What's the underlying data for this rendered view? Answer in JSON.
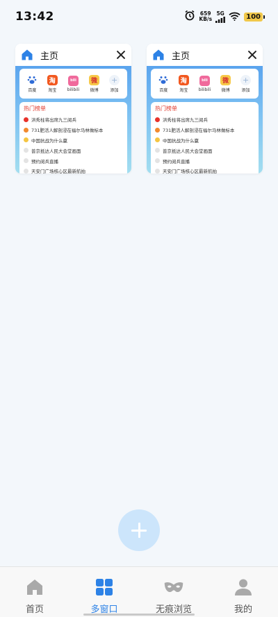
{
  "status_bar": {
    "time": "13:42",
    "speed_value": "659",
    "speed_unit": "KB/s",
    "network": "5G",
    "battery": "100"
  },
  "tabs": [
    {
      "title": "主页",
      "quick_links": [
        "百度",
        "淘宝",
        "bilibili",
        "微博",
        "添加"
      ],
      "hot_title": "热门榜单",
      "hot_items": [
        "洪秀柱将出席九三阅兵",
        "731肥活人解剖浸在福尔马林做标本",
        "中国抗战为什么赢",
        "普京抵达人民大会堂画面",
        "预约阅兵直播",
        "天安门广场核心区最新航拍"
      ]
    },
    {
      "title": "主页",
      "quick_links": [
        "百度",
        "淘宝",
        "bilibili",
        "微博",
        "添加"
      ],
      "hot_title": "热门榜单",
      "hot_items": [
        "洪秀柱将出席九三阅兵",
        "731肥活人解剖浸在福尔马林做标本",
        "中国抗战为什么赢",
        "普京抵达人民大会堂画面",
        "预约阅兵直播",
        "天安门广场核心区最新航拍"
      ]
    }
  ],
  "quick_icons": {
    "baidu": "du",
    "taobao": "淘",
    "bilibili": "bili",
    "weibo": "微",
    "add": "+"
  },
  "bottom_nav": [
    {
      "label": "首页",
      "icon": "home-icon",
      "active": false
    },
    {
      "label": "多窗口",
      "icon": "windows-grid-icon",
      "active": true
    },
    {
      "label": "无痕浏览",
      "icon": "mask-icon",
      "active": false
    },
    {
      "label": "我的",
      "icon": "profile-icon",
      "active": false
    }
  ],
  "colors": {
    "accent": "#2d82e6",
    "hot_red": "#e23b2e",
    "fab": "#cce5fb"
  }
}
